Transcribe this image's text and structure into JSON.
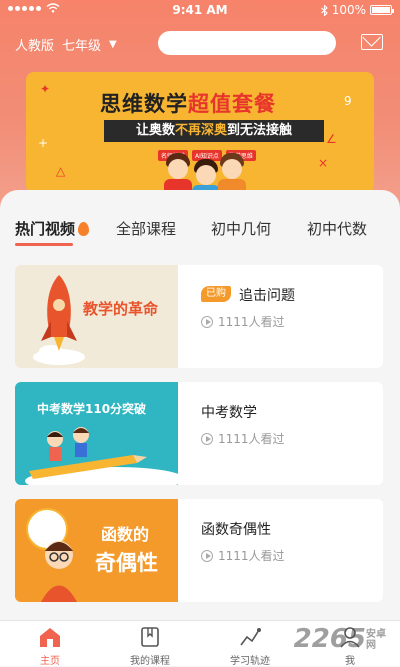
{
  "status": {
    "time": "9:41 AM",
    "battery": "100%"
  },
  "header": {
    "edition": "人教版",
    "grade": "七年级"
  },
  "banner": {
    "title_prefix": "思维数学",
    "title_highlight": "超值套餐",
    "subtitle_a": "让奥数",
    "subtitle_b": "不再深奥",
    "subtitle_c": "到无法接触",
    "tags": [
      "名师精讲",
      "AI知识点",
      "数学思维"
    ]
  },
  "tabs": [
    "热门视频",
    "全部课程",
    "初中几何",
    "初中代数"
  ],
  "cards": [
    {
      "title": "追击问题",
      "badge": "已购",
      "views": "1111人看过",
      "thumb_text": "教学的革命"
    },
    {
      "title": "中考数学",
      "views": "1111人看过",
      "thumb_text": "中考数学110分突破"
    },
    {
      "title": "函数奇偶性",
      "views": "1111人看过",
      "thumb_text_1": "函数的",
      "thumb_text_2": "奇偶性"
    }
  ],
  "tabbar": [
    "主页",
    "我的课程",
    "学习轨迹",
    "我"
  ],
  "watermark": {
    "brand": "2265",
    "suffix": "安卓网"
  },
  "colors": {
    "accent": "#f0644f",
    "header": "#f6836a",
    "badge": "#f39a2b"
  }
}
